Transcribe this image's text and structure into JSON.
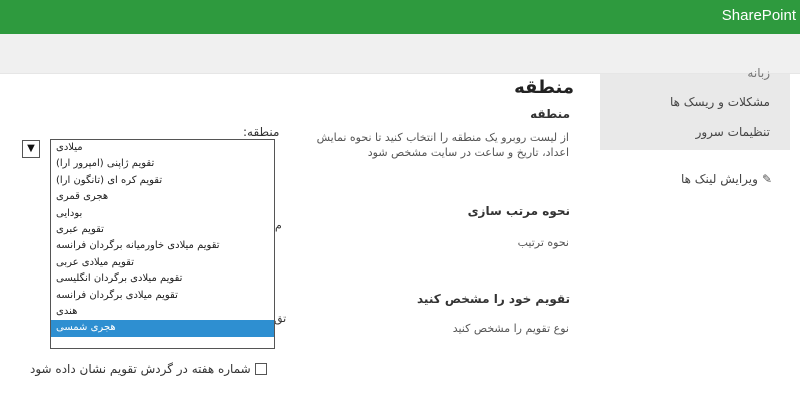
{
  "header": {
    "brand": "SharePoint",
    "bar_color": "#2e9a3e"
  },
  "leftnav": {
    "partial_label": "زبانه",
    "items": [
      "مشکلات و ریسک ها",
      "تنظیمات سرور"
    ],
    "edit_links": "ویرایش لینک ها",
    "edit_icon": "pencil-icon"
  },
  "page": {
    "title": "منطقه"
  },
  "sections": {
    "region": {
      "title": "منطقه",
      "desc_line1": "از لیست روبرو یک منطقه را انتخاب کنید تا نحوه نمایش",
      "desc_line2": "اعداد، تاریخ و ساعت در سایت مشخص شود"
    },
    "sort": {
      "title": "نحوه مرتب سازی",
      "desc": "نحوه ترتیب"
    },
    "calendar": {
      "title": "تقویم خود را مشخص کنید",
      "desc": "نوع تقویم را مشخص کنید"
    }
  },
  "form": {
    "region_label": "منطقه:",
    "stray_1": "م",
    "stray_2": "تق",
    "dropdown_options": [
      "میلادی",
      "تقویم ژاپنی (امپرور ارا)",
      "تقویم کره ای (تانگون ارا)",
      "هجری قمری",
      "بودایی",
      "تقویم عبری",
      "تقویم میلادی خاورمیانه برگردان فرانسه",
      "تقویم میلادی عربی",
      "تقویم میلادی برگردان انگلیسی",
      "تقویم میلادی برگردان فرانسه",
      "هندی",
      "هجری شمسی"
    ],
    "selected_index": 11,
    "selection_color": "#2e8fd1",
    "week_numbers_label": "شماره هفته در گردش تقویم نشان داده شود"
  }
}
